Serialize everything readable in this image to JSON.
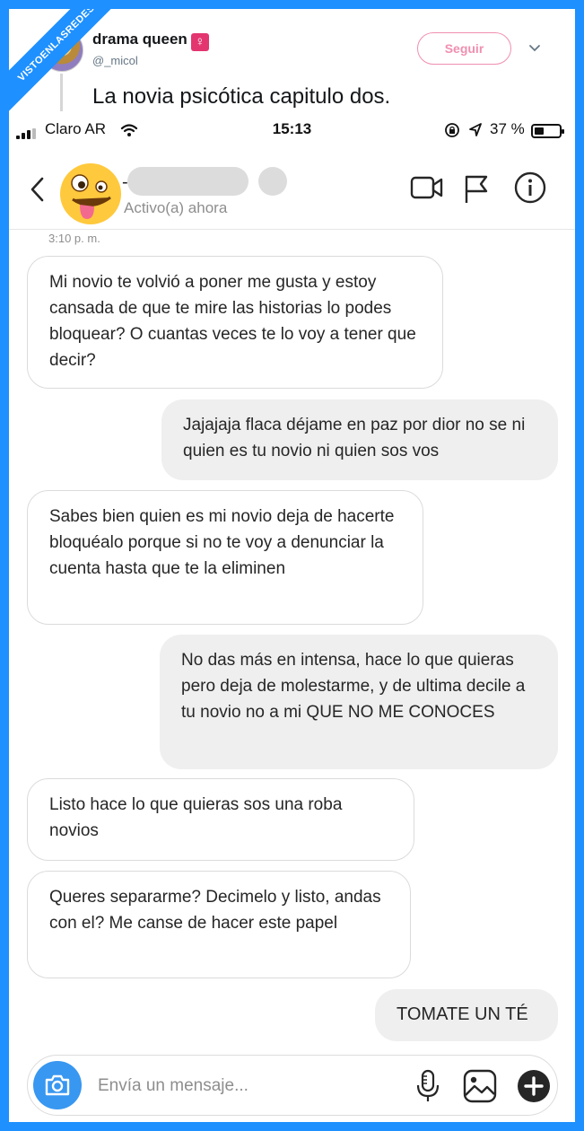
{
  "watermark": "VISTOENLASREDES",
  "tweet": {
    "display_name": "drama queen",
    "badge": "♀",
    "handle": "@_micol",
    "follow_label": "Seguir",
    "text": "La novia psicótica capitulo dos."
  },
  "status_bar": {
    "carrier": "Claro AR",
    "time": "15:13",
    "battery_percent": "37 %",
    "battery_level": 0.37
  },
  "chat": {
    "activity": "Activo(a) ahora",
    "timestamp": "3:10 p. m.",
    "messages": [
      {
        "side": "in",
        "text": "Mi novio te volvió a poner me gusta y estoy cansada de que te mire las historias lo podes bloquear? O cuantas veces te lo voy a tener que decir?"
      },
      {
        "side": "out",
        "text": "Jajajaja flaca déjame en paz por dior no se ni quien es tu novio ni quien sos vos"
      },
      {
        "side": "in",
        "text": "Sabes bien quien es mi novio deja de hacerte bloquéalo porque si no te voy a denunciar la cuenta hasta que te la eliminen"
      },
      {
        "side": "out",
        "text": "No das más en intensa, hace lo que quieras pero deja de molestarme, y de ultima decile a tu novio no a mi QUE NO ME CONOCES"
      },
      {
        "side": "in",
        "text": "Listo hace lo que quieras sos una roba novios"
      },
      {
        "side": "in",
        "text": "Queres separarme? Decimelo y listo, andas con el? Me canse de hacer este papel"
      },
      {
        "side": "out",
        "text": "TOMATE UN TÉ"
      }
    ],
    "composer_placeholder": "Envía un mensaje..."
  },
  "colors": {
    "frame_blue": "#1e90ff",
    "follow_pink": "#f08fb1",
    "camera_blue": "#3897f0",
    "out_bubble": "#efefef"
  }
}
